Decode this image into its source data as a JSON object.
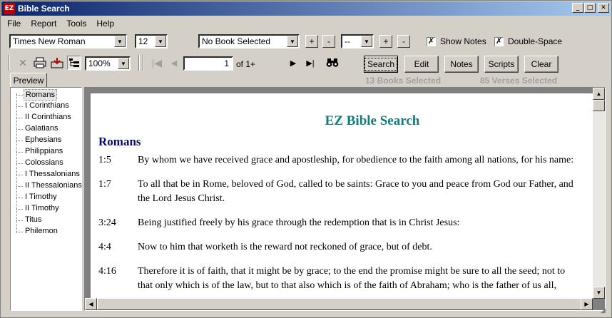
{
  "window": {
    "title": "Bible Search",
    "app_icon": "EZ"
  },
  "menu": [
    "File",
    "Report",
    "Tools",
    "Help"
  ],
  "format": {
    "font": "Times New Roman",
    "size": "12",
    "book": "No Book Selected",
    "chapter": "--",
    "plus": "+",
    "minus": "-",
    "show_notes_label": "Show Notes",
    "double_space_label": "Double-Space",
    "check": "✗"
  },
  "toolbar": {
    "zoom": "100%",
    "page_value": "1",
    "page_of": "of 1+",
    "search": "Search",
    "edit": "Edit",
    "notes": "Notes",
    "scripts": "Scripts",
    "clear": "Clear",
    "books_selected": "13 Books Selected",
    "verses_selected": "85 Verses Selected"
  },
  "tab": "Preview",
  "tree": [
    "Romans",
    "I Corinthians",
    "II Corinthians",
    "Galatians",
    "Ephesians",
    "Philippians",
    "Colossians",
    "I Thessalonians",
    "II Thessalonians",
    "I Timothy",
    "II Timothy",
    "Titus",
    "Philemon"
  ],
  "report": {
    "title": "EZ Bible Search",
    "book": "Romans",
    "verses": [
      {
        "ref": "1:5",
        "lines": [
          "By whom we have received grace and apostleship, for obedience to the faith among all nations, for his name:"
        ]
      },
      {
        "ref": "1:7",
        "lines": [
          "To all that be in Rome, beloved of God, called to be saints: Grace to you and peace from God our Father, and",
          "the Lord Jesus Christ."
        ]
      },
      {
        "ref": "3:24",
        "lines": [
          "Being justified freely by his grace through the redemption that is in Christ Jesus:"
        ]
      },
      {
        "ref": "4:4",
        "lines": [
          "Now to him that worketh is the reward not reckoned of grace, but of debt."
        ]
      },
      {
        "ref": "4:16",
        "lines": [
          "Therefore it is of faith, that it might be by grace; to the end the promise might be sure to all the seed; not to",
          "that only which is of the law, but to that also which is of the faith of Abraham; who is the father of us all,"
        ]
      }
    ]
  }
}
